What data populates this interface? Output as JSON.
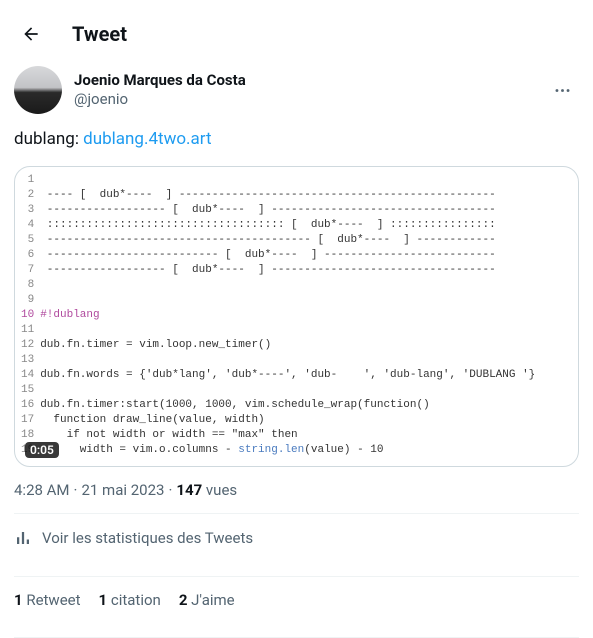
{
  "header": {
    "title": "Tweet"
  },
  "author": {
    "name": "Joenio Marques da Costa",
    "handle": "@joenio"
  },
  "body": {
    "prefix": "dublang: ",
    "link_text": "dublang.4two.art"
  },
  "code": {
    "lines": [
      "",
      " ---- [  dub*----  ] ------------------------------------------------",
      " ------------------ [  dub*----  ] ----------------------------------",
      " :::::::::::::::::::::::::::::::::::: [  dub*----  ] ::::::::::::::::",
      " ---------------------------------------- [  dub*----  ] ------------",
      " -------------------------- [  dub*----  ] --------------------------",
      " ------------------ [  dub*----  ] ----------------------------------",
      "",
      "",
      "#!dublang",
      "",
      "dub.fn.timer = vim.loop.new_timer()",
      "",
      "dub.fn.words = {'dub*lang', 'dub*----', 'dub-    ', 'dub-lang', 'DUBLANG '}",
      "",
      "dub.fn.timer:start(1000, 1000, vim.schedule_wrap(function()",
      "  function draw_line(value, width)",
      "    if not width or width == \"max\" then",
      "      width = vim.o.columns - string.len(value) - 10"
    ],
    "comment_line_index": 9,
    "highlight_token": "string.len",
    "time_badge": "0:05"
  },
  "meta": {
    "time": "4:28 AM",
    "sep": " · ",
    "date": "21 mai 2023",
    "views_count": "147",
    "views_label": " vues"
  },
  "stats_link": {
    "label": "Voir les statistiques des Tweets"
  },
  "counts": {
    "retweets_n": "1",
    "retweets_label": " Retweet",
    "quotes_n": "1",
    "quotes_label": " citation",
    "likes_n": "2",
    "likes_label": " J'aime"
  }
}
